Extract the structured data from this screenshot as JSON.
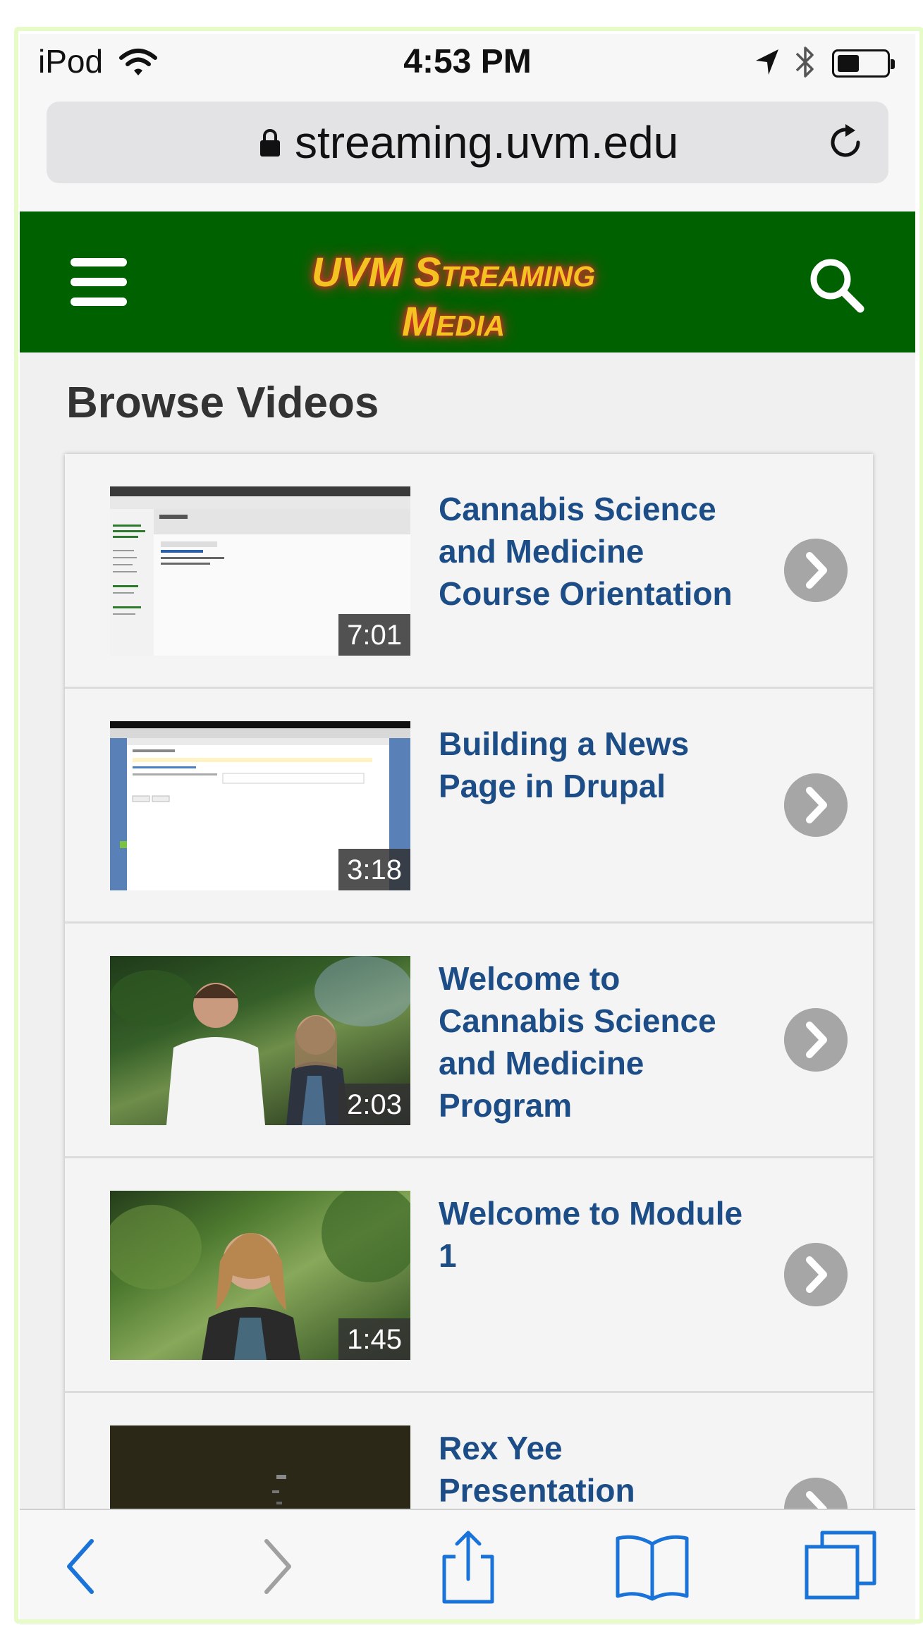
{
  "status_bar": {
    "carrier": "iPod",
    "time": "4:53 PM",
    "battery_level": 0.45
  },
  "browser": {
    "url": "streaming.uvm.edu"
  },
  "header": {
    "logo_line1": "UVM Streaming",
    "logo_line2": "Media",
    "brand_color": "#006100",
    "logo_color": "#f3c322"
  },
  "page": {
    "heading": "Browse Videos"
  },
  "videos": [
    {
      "title": "Cannabis Science and Medicine Course Orientation",
      "duration": "7:01"
    },
    {
      "title": "Building a News Page in Drupal",
      "duration": "3:18"
    },
    {
      "title": "Welcome to Cannabis Science and Medicine Program",
      "duration": "2:03"
    },
    {
      "title": "Welcome to Module 1",
      "duration": "1:45"
    },
    {
      "title": "Rex Yee Presentation",
      "duration": ""
    }
  ],
  "toolbar": {
    "icons": [
      "back-icon",
      "forward-icon",
      "share-icon",
      "bookmarks-icon",
      "tabs-icon"
    ],
    "accent_color": "#1a73d9"
  }
}
